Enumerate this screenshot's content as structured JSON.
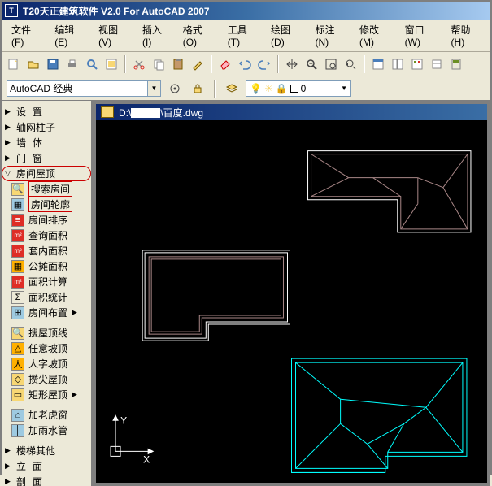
{
  "app": {
    "title": "T20天正建筑软件 V2.0 For AutoCAD 2007",
    "icon_text": "T"
  },
  "menu": {
    "items": [
      {
        "label": "文件(F)"
      },
      {
        "label": "编辑(E)"
      },
      {
        "label": "视图(V)"
      },
      {
        "label": "插入(I)"
      },
      {
        "label": "格式(O)"
      },
      {
        "label": "工具(T)"
      },
      {
        "label": "绘图(D)"
      },
      {
        "label": "标注(N)"
      },
      {
        "label": "修改(M)"
      },
      {
        "label": "窗口(W)"
      },
      {
        "label": "帮助(H)"
      }
    ]
  },
  "workspace": {
    "combo_value": "AutoCAD 经典"
  },
  "layer": {
    "name": "0"
  },
  "doc": {
    "prefix": "D:\\",
    "suffix": "\\百度.dwg"
  },
  "tree": {
    "top": [
      {
        "label": "设置"
      },
      {
        "label": "轴网柱子"
      },
      {
        "label": "墙体"
      },
      {
        "label": "门窗"
      }
    ],
    "expanded": {
      "label": "房间屋顶"
    },
    "subs": [
      {
        "icon_bg": "#f7d774",
        "icon_txt": "🔍",
        "label": "搜索房间",
        "box": true
      },
      {
        "icon_bg": "#9ecae1",
        "icon_txt": "▦",
        "label": "房间轮廓",
        "box": true
      },
      {
        "icon_bg": "#de2d26",
        "icon_txt": "≡",
        "label": "房间排序"
      },
      {
        "icon_bg": "#de2d26",
        "icon_txt": "m²",
        "label": "查询面积"
      },
      {
        "icon_bg": "#de2d26",
        "icon_txt": "m²",
        "label": "套内面积"
      },
      {
        "icon_bg": "#ffb000",
        "icon_txt": "▦",
        "label": "公摊面积"
      },
      {
        "icon_bg": "#de2d26",
        "icon_txt": "m²",
        "label": "面积计算"
      },
      {
        "icon_bg": "#ece9d8",
        "icon_txt": "Σ",
        "label": "面积统计"
      },
      {
        "icon_bg": "#9ecae1",
        "icon_txt": "⊞",
        "label": "房间布置",
        "arrow": true
      }
    ],
    "subs2": [
      {
        "icon_bg": "#f7d774",
        "icon_txt": "🔍",
        "label": "搜屋顶线"
      },
      {
        "icon_bg": "#ffb000",
        "icon_txt": "△",
        "label": "任意坡顶"
      },
      {
        "icon_bg": "#ffb000",
        "icon_txt": "人",
        "label": "人字坡顶"
      },
      {
        "icon_bg": "#f7d774",
        "icon_txt": "◇",
        "label": "攒尖屋顶"
      },
      {
        "icon_bg": "#f7d774",
        "icon_txt": "▭",
        "label": "矩形屋顶",
        "arrow": true
      }
    ],
    "subs3": [
      {
        "icon_bg": "#9ecae1",
        "icon_txt": "⌂",
        "label": "加老虎窗"
      },
      {
        "icon_bg": "#9ecae1",
        "icon_txt": "│",
        "label": "加雨水管"
      }
    ],
    "bottom": [
      {
        "label": "楼梯其他"
      },
      {
        "label": "立面"
      },
      {
        "label": "剖面"
      }
    ]
  },
  "ucs": {
    "x": "X",
    "y": "Y"
  }
}
